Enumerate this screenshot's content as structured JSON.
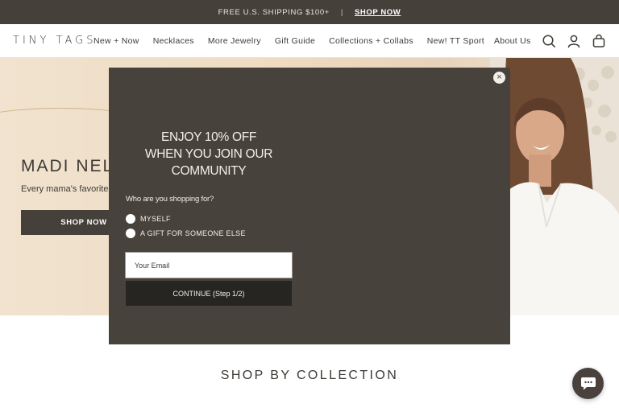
{
  "announcement": {
    "text": "FREE U.S. SHIPPING $100+",
    "separator": "|",
    "link": "SHOP NOW"
  },
  "header": {
    "logo": "TINY TAGS",
    "nav": [
      "New + Now",
      "Necklaces",
      "More Jewelry",
      "Gift Guide",
      "Collections + Collabs",
      "New! TT Sport"
    ],
    "about": "About Us",
    "icons": [
      "search-icon",
      "account-icon",
      "cart-icon"
    ]
  },
  "hero": {
    "title": "MADI NELS",
    "subtitle": "Every mama's favorite",
    "button": "SHOP NOW"
  },
  "modal": {
    "title_line1": "ENJOY 10% OFF",
    "title_line2": "WHEN YOU JOIN OUR",
    "title_line3": "COMMUNITY",
    "question": "Who are you shopping for?",
    "options": [
      "MYSELF",
      "A GIFT FOR SOMEONE ELSE"
    ],
    "email_placeholder": "Your Email",
    "continue": "CONTINUE (Step 1/2)",
    "close_glyph": "×"
  },
  "section": {
    "title": "SHOP BY COLLECTION"
  },
  "colors": {
    "announcement_bg": "#45403a",
    "modal_bg": "#47423b",
    "button_dark": "#272522",
    "hero_bg": "#eedbc2"
  }
}
